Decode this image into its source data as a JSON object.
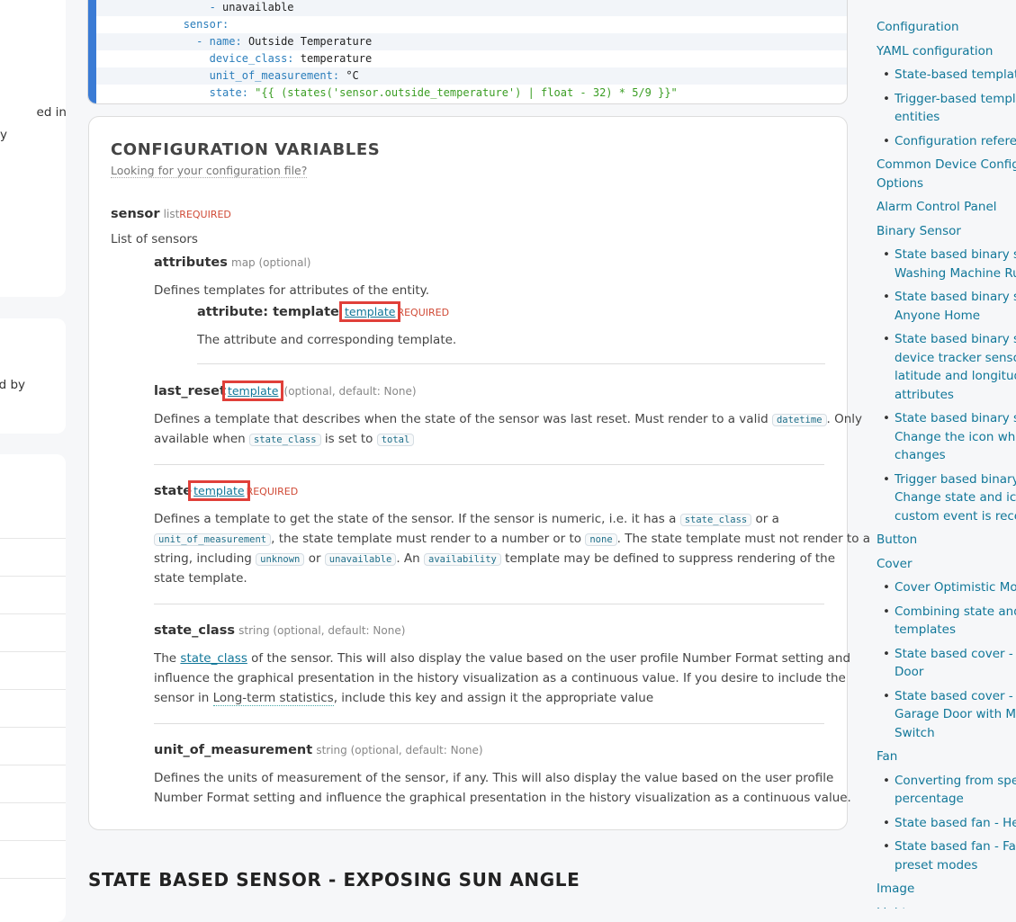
{
  "left": {
    "fragment1a": "ed in",
    "fragment1b": "y",
    "fragment2": "d by"
  },
  "code": {
    "lines": [
      {
        "indent": "    ",
        "key": "- ",
        "val": "unavailable"
      },
      {
        "indent": "",
        "key": "sensor:",
        "val": ""
      },
      {
        "indent": "  ",
        "key": "- name: ",
        "val": "Outside Temperature"
      },
      {
        "indent": "    ",
        "key": "device_class: ",
        "val": "temperature"
      },
      {
        "indent": "    ",
        "key": "unit_of_measurement: ",
        "val": "°C"
      },
      {
        "indent": "    ",
        "key": "state: ",
        "str": "\"{{ (states('sensor.outside_temperature') | float - 32) * 5/9 }}\""
      }
    ]
  },
  "config": {
    "title": "CONFIGURATION VARIABLES",
    "subtitle": "Looking for your configuration file?",
    "sensor": {
      "name": "sensor",
      "type": "list",
      "req": "REQUIRED",
      "desc": "List of sensors"
    },
    "attributes": {
      "name": "attributes",
      "type": "map (optional)",
      "desc": "Defines templates for attributes of the entity."
    },
    "attribute_template": {
      "name": "attribute: template",
      "link": "template",
      "req": "REQUIRED",
      "desc": "The attribute and corresponding template."
    },
    "last_reset": {
      "name": "last_reset",
      "link": "template",
      "type": "(optional, default: None)",
      "desc1": "Defines a template that describes when the state of the sensor was last reset. Must render to a valid",
      "code1": "datetime",
      "desc2": ". Only",
      "desc3": "available when",
      "code2": "state_class",
      "desc4": "is set to",
      "code3": "total"
    },
    "state": {
      "name": "state",
      "link": "template",
      "req": "REQUIRED",
      "l1a": "Defines a template to get the state of the sensor. If the sensor is numeric, i.e. it has a",
      "l1c": "state_class",
      "l1b": "or a",
      "l2c1": "unit_of_measurement",
      "l2a": ", the state template must render to a number or to",
      "l2c2": "none",
      "l2b": ". The state template must not render to a",
      "l3a": "string, including",
      "l3c1": "unknown",
      "l3b": "or",
      "l3c2": "unavailable",
      "l3d": ". An",
      "l3c3": "availability",
      "l3e": "template may be defined to suppress rendering of the",
      "l4": "state template."
    },
    "state_class": {
      "name": "state_class",
      "type": "string (optional, default: None)",
      "l1a": "The",
      "l1link": "state_class",
      "l1b": "of the sensor. This will also display the value based on the user profile Number Format setting and",
      "l2": "influence the graphical presentation in the history visualization as a continuous value. If you desire to include the",
      "l3a": "sensor in",
      "l3link": "Long-term statistics",
      "l3b": ", include this key and assign it the appropriate value"
    },
    "unit": {
      "name": "unit_of_measurement",
      "type": "string (optional, default: None)",
      "l1": "Defines the units of measurement of the sensor, if any. This will also display the value based on the user profile",
      "l2": "Number Format setting and influence the graphical presentation in the history visualization as a continuous value."
    }
  },
  "section_heading": "STATE BASED SENSOR - EXPOSING SUN ANGLE",
  "toc": {
    "items": [
      {
        "kind": "top",
        "text": "Configuration"
      },
      {
        "kind": "top",
        "text": "YAML configuration"
      },
      {
        "kind": "sub",
        "text": "State-based template"
      },
      {
        "kind": "sub",
        "text": "Trigger-based templa",
        "text2": "entities"
      },
      {
        "kind": "sub",
        "text": "Configuration referen"
      },
      {
        "kind": "top",
        "text": "Common Device Configu",
        "text2": "Options"
      },
      {
        "kind": "top",
        "text": "Alarm Control Panel"
      },
      {
        "kind": "top",
        "text": "Binary Sensor"
      },
      {
        "kind": "sub",
        "text": "State based binary ser",
        "text2": "Washing Machine Run"
      },
      {
        "kind": "sub",
        "text": "State based binary ser",
        "text2": "Anyone Home"
      },
      {
        "kind": "sub",
        "text": "State based binary ser",
        "text2": "device tracker sensor",
        "text3": "latitude and longitude",
        "text4": "attributes"
      },
      {
        "kind": "sub",
        "text": "State based binary ser",
        "text2": "Change the icon wher",
        "text3": "changes"
      },
      {
        "kind": "sub",
        "text": "Trigger based binary s",
        "text2": "Change state and icor",
        "text3": "custom event is receiv"
      },
      {
        "kind": "top",
        "text": "Button"
      },
      {
        "kind": "top",
        "text": "Cover"
      },
      {
        "kind": "sub",
        "text": "Cover Optimistic Mod"
      },
      {
        "kind": "sub",
        "text": "Combining state and p",
        "text2": "templates"
      },
      {
        "kind": "sub",
        "text": "State based cover - Ga",
        "text2": "Door"
      },
      {
        "kind": "sub",
        "text": "State based cover - O",
        "text2": "Garage Door with Mor",
        "text3": "Switch"
      },
      {
        "kind": "top",
        "text": "Fan"
      },
      {
        "kind": "sub",
        "text": "Converting from spee",
        "text2": "percentage"
      },
      {
        "kind": "sub",
        "text": "State based fan - Help"
      },
      {
        "kind": "sub",
        "text": "State based fan - Fan",
        "text2": "preset modes"
      },
      {
        "kind": "top",
        "text": "Image"
      },
      {
        "kind": "top",
        "text": "Light"
      }
    ]
  }
}
